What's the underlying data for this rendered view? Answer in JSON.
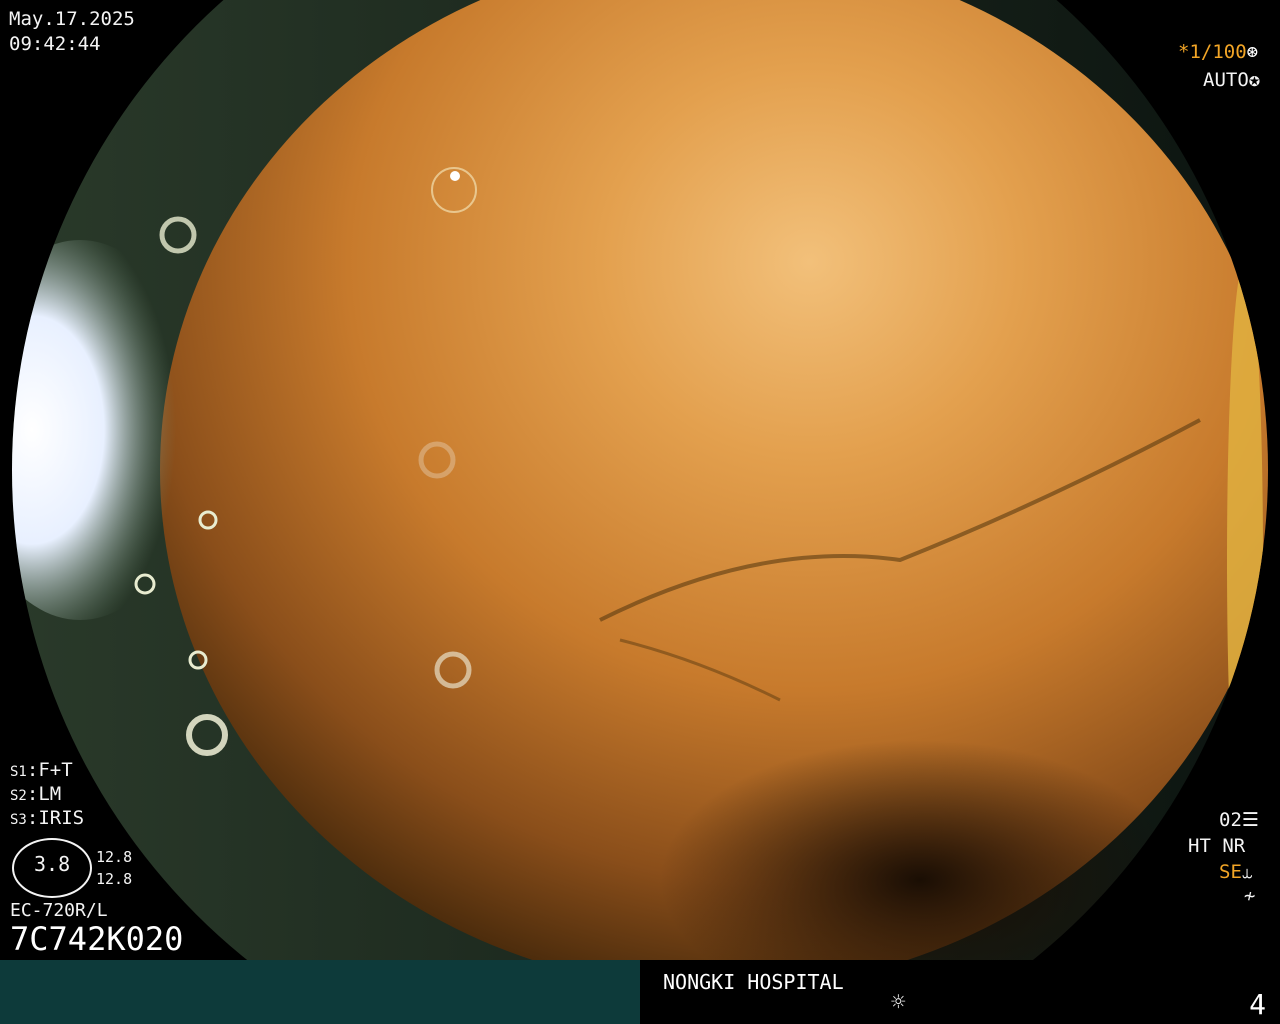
{
  "timestamp": {
    "date": "May.17.2025",
    "time": "09:42:44"
  },
  "exposure": {
    "shutter": "*1/100",
    "shutter_icon": "aperture-icon",
    "mode": "AUTO",
    "mode_icon": "iris-icon"
  },
  "settings": [
    {
      "key": "S1",
      "value": "F+T"
    },
    {
      "key": "S2",
      "value": "LM"
    },
    {
      "key": "S3",
      "value": "IRIS"
    }
  ],
  "zoom": {
    "value": "3.8",
    "upper": "12.8",
    "lower": "12.8"
  },
  "scope": {
    "model": "EC-720R/L",
    "serial": "7C742K020"
  },
  "processing": {
    "line1": "02",
    "line1_icon": "structure-icon",
    "ht": "HT",
    "nr": "NR",
    "se": "SE",
    "se_icon": "se-curve-icon",
    "freeze_icon": "freeze-icon"
  },
  "footer": {
    "hospital": "NONGKI HOSPITAL",
    "light_icon": "sun-icon",
    "page": "4"
  },
  "colors": {
    "accent": "#f2a526",
    "text": "#f4f4f4",
    "footer_bg": "#0d3a3a"
  }
}
